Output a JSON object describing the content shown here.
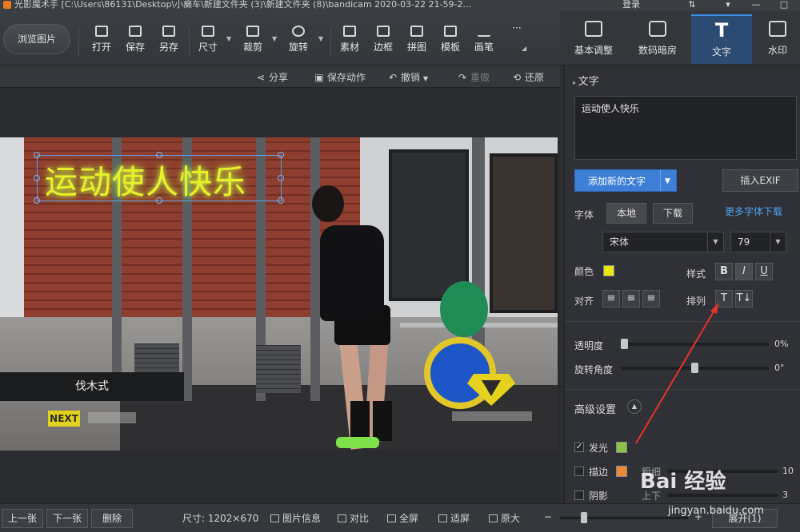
{
  "title_bar": {
    "title": "光影魔术手  [C:\\Users\\86131\\Desktop\\小癞车\\新建文件夹 (3)\\新建文件夹 (8)\\bandicam 2020-03-22 21-59-2...",
    "login": "登录",
    "controls": [
      "⇅",
      "▾",
      "—",
      "□"
    ]
  },
  "toolbar": {
    "browse": "浏览图片",
    "items": [
      "打开",
      "保存",
      "另存",
      "尺寸",
      "裁剪",
      "旋转",
      "素材",
      "边框",
      "拼图",
      "模板",
      "画笔"
    ],
    "more": "···"
  },
  "right_tabs": {
    "items": [
      {
        "label": "基本调整",
        "icon": "adjust-icon"
      },
      {
        "label": "数码暗房",
        "icon": "camera-icon"
      },
      {
        "label": "文字",
        "icon": "text-icon"
      },
      {
        "label": "水印",
        "icon": "watermark-icon"
      }
    ],
    "active": "文字"
  },
  "action_bar": {
    "share": "分享",
    "save_action": "保存动作",
    "undo": "撤销",
    "redo": "重做",
    "restore": "还原"
  },
  "canvas": {
    "caption_text": "运动使人快乐",
    "lower_third": "伐木式",
    "next_badge": "NEXT",
    "caption_color": "#e9f02a"
  },
  "text_panel": {
    "section_title": "文字",
    "text_value": "运动使人快乐",
    "add_text": "添加新的文字",
    "insert_exif": "插入EXIF",
    "font_label": "字体",
    "font_local": "本地",
    "font_download": "下载",
    "more_fonts": "更多字体下载",
    "font_name": "宋体",
    "font_size": "79",
    "color_label": "颜色",
    "color_value": "#e8e80e",
    "style_label": "样式",
    "style_bold": "B",
    "style_italic": "I",
    "style_underline": "U",
    "align_label": "对齐",
    "arrange_label": "排列",
    "opacity_label": "透明度",
    "opacity_value": "0%",
    "rotate_label": "旋转角度",
    "rotate_value": "0°",
    "advanced_title": "高级设置",
    "glow_label": "发光",
    "glow_checked": true,
    "glow_color": "#8bc34a",
    "stroke_label": "描边",
    "stroke_color": "#e88a3a",
    "stroke_sub": "粗细",
    "stroke_value": "10",
    "shadow_label": "阴影",
    "shadow_sub": "上下",
    "shadow_value": "3"
  },
  "bottom_bar": {
    "prev": "上一张",
    "next": "下一张",
    "delete": "删除",
    "size": "尺寸: 1202×670",
    "info": "图片信息",
    "compare": "对比",
    "fullscreen": "全屏",
    "fit": "适屏",
    "original": "原大",
    "expand": "展开(1)"
  },
  "watermark": {
    "brand": "Bai 经验",
    "url": "jingyan.baidu.com"
  }
}
